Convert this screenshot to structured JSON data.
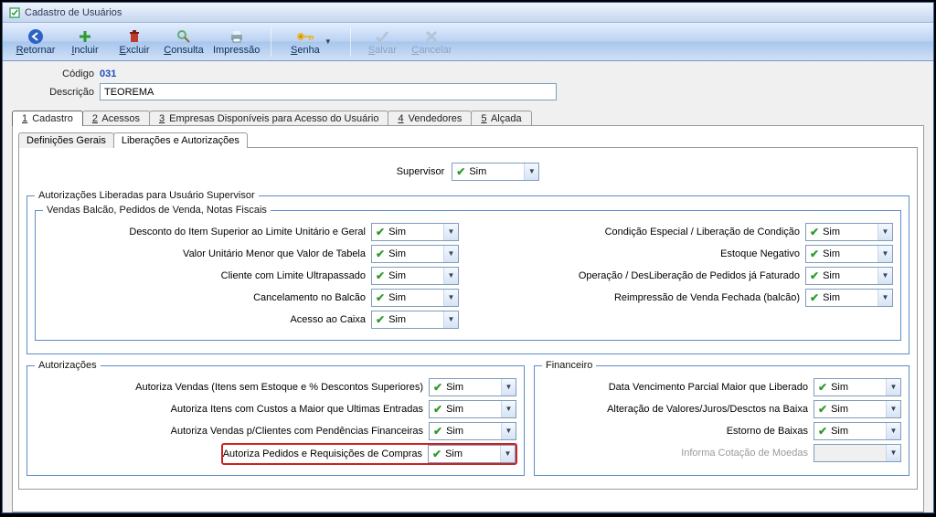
{
  "window": {
    "title": "Cadastro de Usuários"
  },
  "toolbar": {
    "retornar": "Retornar",
    "incluir": "Incluir",
    "excluir": "Excluir",
    "consulta": "Consulta",
    "impressao": "Impressão",
    "senha": "Senha",
    "salvar": "Salvar",
    "cancelar": "Cancelar"
  },
  "header": {
    "codigo_label": "Código",
    "codigo_value": "031",
    "descricao_label": "Descrição",
    "descricao_value": "TEOREMA"
  },
  "tabs": {
    "t1": "Cadastro",
    "t2": "Acessos",
    "t3": "Empresas Disponíveis para Acesso do Usuário",
    "t4": "Vendedores",
    "t5": "Alçada"
  },
  "subtabs": {
    "s1": "Definições Gerais",
    "s2": "Liberações e Autorizações"
  },
  "labels": {
    "supervisor": "Supervisor",
    "group_supervisor": "Autorizações Liberadas para Usuário Supervisor",
    "group_vendas": "Vendas Balcão, Pedidos de Venda, Notas Fiscais",
    "desc_item": "Desconto do Item Superior ao Limite Unitário e Geral",
    "valor_unit": "Valor Unitário Menor que Valor de Tabela",
    "cliente_limite": "Cliente com Limite Ultrapassado",
    "cancel_balcao": "Cancelamento no Balcão",
    "acesso_caixa": "Acesso ao Caixa",
    "cond_especial": "Condição Especial / Liberação de Condição",
    "estoque_neg": "Estoque Negativo",
    "oper_deslib": "Operação / DesLiberação de Pedidos já Faturado",
    "reimpressao": "Reimpressão de Venda Fechada (balcão)",
    "group_autorizacoes": "Autorizações",
    "aut_vendas": "Autoriza Vendas (Itens sem Estoque e % Descontos Superiores)",
    "aut_custos": "Autoriza Itens com Custos a Maior que Ultimas Entradas",
    "aut_pend": "Autoriza Vendas p/Clientes com Pendências Financeiras",
    "aut_pedidos": "Autoriza Pedidos e Requisições de Compras",
    "group_financeiro": "Financeiro",
    "data_venc": "Data Vencimento Parcial Maior que Liberado",
    "alt_valores": "Alteração de Valores/Juros/Desctos na Baixa",
    "estorno": "Estorno de Baixas",
    "cotacao": "Informa Cotação de Moedas"
  },
  "values": {
    "sim": "Sim"
  }
}
